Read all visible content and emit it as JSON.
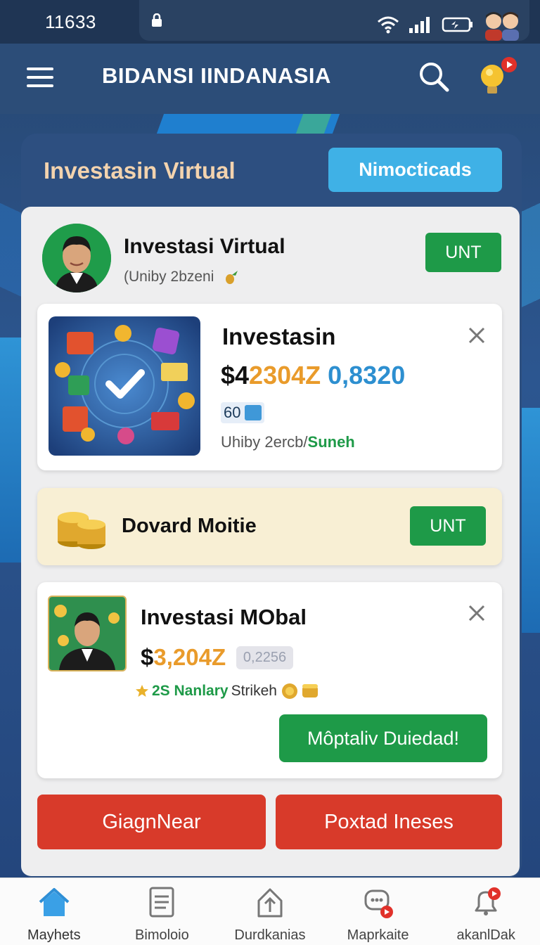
{
  "status_bar": {
    "time": "11633"
  },
  "header": {
    "title": "BIDANSI IINDANASIA"
  },
  "panel": {
    "title": "Investasin Virtual",
    "nearby_button": "Nimocticads"
  },
  "profile": {
    "name": "Investasi Virtual",
    "subtitle": "(Uniby 2bzeni",
    "button": "UNT"
  },
  "card_investasin": {
    "title": "Investasin",
    "price_prefix": "$4",
    "price_main": "2304Z",
    "price_secondary": "0,8320",
    "badge_count": "60",
    "sub_text": "Uhiby 2ercb/",
    "sub_highlight": "Suneh"
  },
  "card_dovard": {
    "title": "Dovard Moitie",
    "button": "UNT"
  },
  "card_mobal": {
    "title": "Investasi MObal",
    "price_prefix": "$",
    "price_main": "3,204Z",
    "price_chip": "0,2256",
    "meta_highlight": "2S Nanlary",
    "meta_text": "Strikeh",
    "action_button": "Môptaliv Duiedad!"
  },
  "actions": {
    "left_button": "GiagnNear",
    "right_button": "Poxtad Ineses"
  },
  "bottom_nav": [
    {
      "label": "Mayhets"
    },
    {
      "label": "Bimoloio"
    },
    {
      "label": "Durdkanias"
    },
    {
      "label": "Maprkaite"
    },
    {
      "label": "akanlDak"
    }
  ],
  "colors": {
    "accent_blue": "#3fb1e6",
    "accent_green": "#1e9a48",
    "accent_red": "#d83a2a",
    "price_orange": "#e99b2b",
    "price_blue": "#2d8fd0"
  }
}
